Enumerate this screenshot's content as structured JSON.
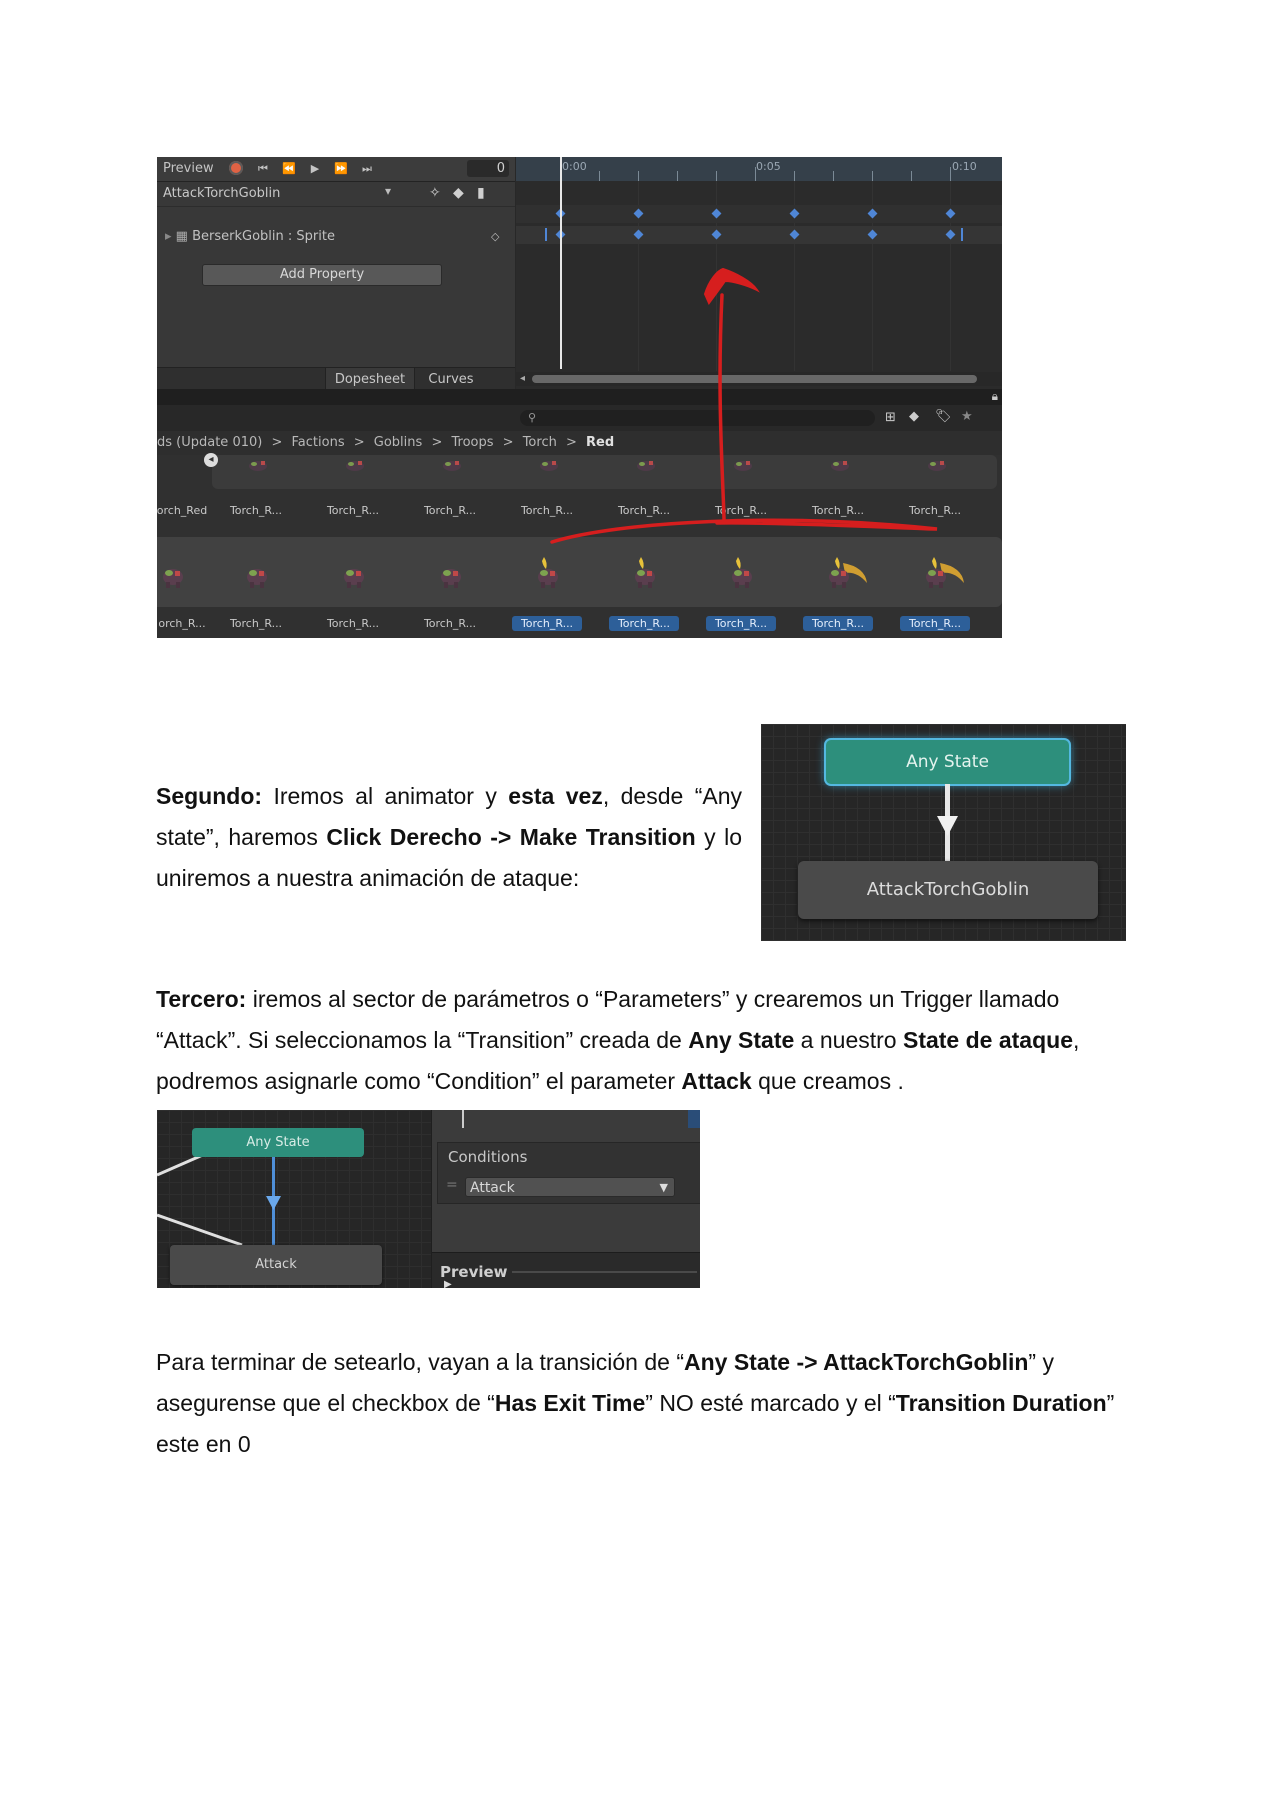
{
  "shot1": {
    "toolbar": {
      "preview_label": "Preview",
      "frame_value": "0"
    },
    "clip_name": "AttackTorchGoblin",
    "property_row": "BerserkGoblin : Sprite",
    "add_property_label": "Add Property",
    "tabs": {
      "dopesheet": "Dopesheet",
      "curves": "Curves"
    },
    "ruler_labels": [
      "0:00",
      "0:05",
      "0:10"
    ],
    "breadcrumb": {
      "items": [
        "ds (Update 010)",
        "Factions",
        "Goblins",
        "Troops",
        "Torch"
      ],
      "current": "Red",
      "separator": ">"
    },
    "row1_labels": [
      "orch_Red",
      "Torch_R...",
      "Torch_R...",
      "Torch_R...",
      "Torch_R...",
      "Torch_R...",
      "Torch_R...",
      "Torch_R...",
      "Torch_R..."
    ],
    "row2_labels": [
      "orch_R...",
      "Torch_R...",
      "Torch_R...",
      "Torch_R...",
      "Torch_R...",
      "Torch_R...",
      "Torch_R...",
      "Torch_R...",
      "Torch_R..."
    ],
    "row2_selected_from": 4,
    "annotation_color": "#d61e1e"
  },
  "paragraphs": {
    "segundo": {
      "lead": "Segundo:",
      "t1": " Iremos al animator y ",
      "b1": "esta vez",
      "t2": ", desde “Any state”, haremos ",
      "b2": "Click Derecho -> Make Transition",
      "t3": " y lo uniremos a nuestra animación de ataque:"
    },
    "tercero": {
      "lead": "Tercero:",
      "t1": " iremos al sector de parámetros o “Parameters” y crearemos un Trigger llamado “Attack”. Si seleccionamos la “Transition” creada de ",
      "b1": "Any State",
      "t2": " a nuestro ",
      "b2": "State de ataque",
      "t3": ", podremos asignarle como “Condition” el parameter ",
      "b3": "Attack",
      "t4": " que creamos ."
    },
    "final": {
      "t1": "Para terminar de setearlo, vayan a la transición de “",
      "b1": "Any State -> AttackTorchGoblin",
      "t2": "” y asegurense que el checkbox de “",
      "b2": "Has Exit Time",
      "t3": "” NO esté marcado y el “",
      "b3": "Transition Duration",
      "t4": "” este en 0"
    }
  },
  "shot2": {
    "any_state": "Any State",
    "attack_state": "AttackTorchGoblin",
    "any_state_color": "#2d8f7c"
  },
  "shot3": {
    "any_state": "Any State",
    "attack_state": "Attack",
    "conditions_title": "Conditions",
    "condition_value": "Attack",
    "preview_label": "Preview",
    "transition_color": "#4f8fd8"
  }
}
